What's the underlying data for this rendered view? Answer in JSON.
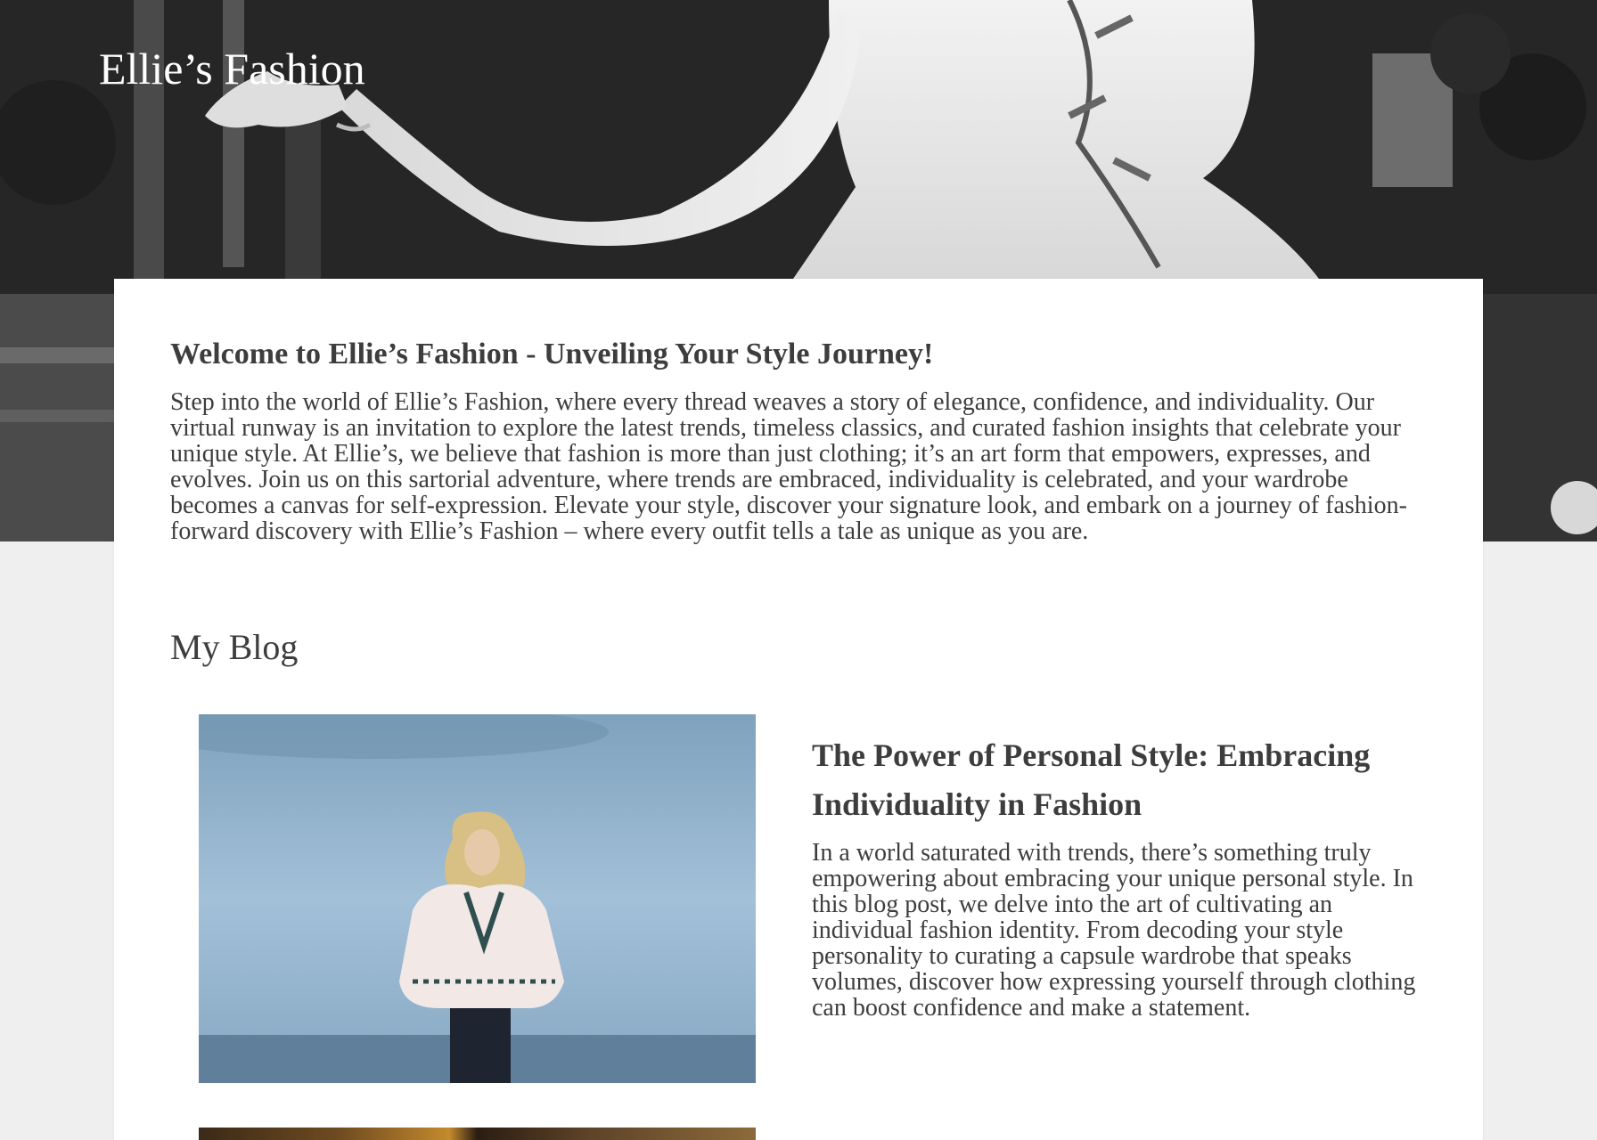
{
  "site": {
    "title": "Ellie’s Fashion"
  },
  "intro": {
    "heading": "Welcome to Ellie’s Fashion - Unveiling Your Style Journey!",
    "body": "Step into the world of Ellie’s Fashion, where every thread weaves a story of elegance, confidence, and individuality. Our virtual runway is an invitation to explore the latest trends, timeless classics, and curated fashion insights that celebrate your unique style. At Ellie’s, we believe that fashion is more than just clothing; it’s an art form that empowers, expresses, and evolves. Join us on this sartorial adventure, where trends are embraced, individuality is celebrated, and your wardrobe becomes a canvas for self-expression. Elevate your style, discover your signature look, and embark on a journey of fashion-forward discovery with Ellie’s Fashion – where every outfit tells a tale as unique as you are."
  },
  "blog": {
    "heading": "My Blog",
    "posts": [
      {
        "title": "The Power of Personal Style: Embracing Individuality in Fashion",
        "excerpt": "In a world saturated with trends, there’s something truly empowering about embracing your unique personal style. In this blog post, we delve into the art of cultivating an individual fashion identity. From decoding your style personality to curating a capsule wardrobe that speaks volumes, discover how expressing yourself through clothing can boost confidence and make a statement."
      }
    ]
  },
  "colors": {
    "text": "#3d3d3d",
    "page_background": "#efefef",
    "card_background": "#ffffff",
    "sky": "#9ebfd8"
  }
}
